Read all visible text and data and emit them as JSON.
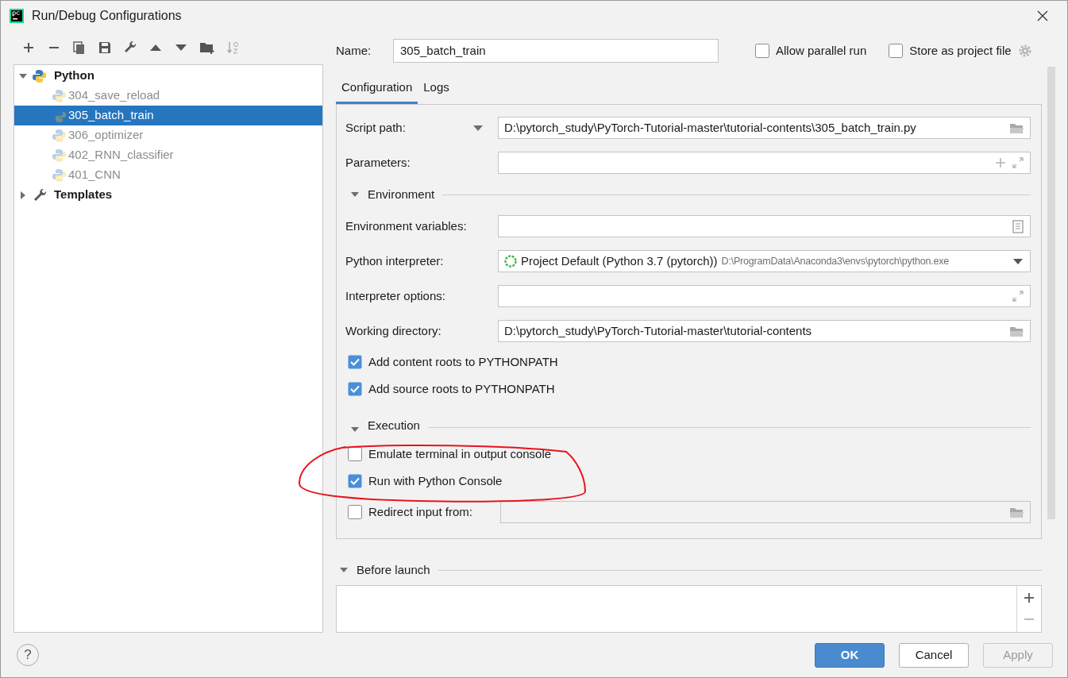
{
  "window": {
    "title": "Run/Debug Configurations"
  },
  "tree": [
    {
      "label": "Python",
      "expanded": true,
      "selected": false,
      "children": [
        {
          "label": "304_save_reload",
          "selected": false
        },
        {
          "label": "305_batch_train",
          "selected": true
        },
        {
          "label": "306_optimizer",
          "selected": false
        },
        {
          "label": "402_RNN_classifier",
          "selected": false
        },
        {
          "label": "401_CNN",
          "selected": false
        }
      ]
    },
    {
      "label": "Templates",
      "expanded": false,
      "selected": false
    }
  ],
  "name": {
    "label": "Name:",
    "value": "305_batch_train"
  },
  "options": [
    {
      "label": "Allow parallel run",
      "checked": false
    },
    {
      "label": "Store as project file",
      "checked": false
    }
  ],
  "tabs": [
    {
      "label": "Configuration",
      "selected": true
    },
    {
      "label": "Logs",
      "selected": false
    }
  ],
  "form": [
    {
      "kind": "script_path",
      "label": "Script path:",
      "value": "D:\\pytorch_study\\PyTorch-Tutorial-master\\tutorial-contents\\305_batch_train.py"
    },
    {
      "kind": "parameters",
      "label": "Parameters:"
    },
    {
      "kind": "section",
      "title": "Environment",
      "expanded": true
    },
    {
      "kind": "env_vars",
      "label": "Environment variables:"
    },
    {
      "kind": "interpreter",
      "label": "Python interpreter:",
      "value": "Project Default (Python 3.7 (pytorch))",
      "detail": "D:\\ProgramData\\Anaconda3\\envs\\pytorch\\python.exe"
    },
    {
      "kind": "interpreter_options",
      "label": "Interpreter options:"
    },
    {
      "kind": "directory",
      "label": "Working directory:",
      "value": "D:\\pytorch_study\\PyTorch-Tutorial-master\\tutorial-contents"
    },
    {
      "kind": "checkbox",
      "label": "Add content roots to PYTHONPATH",
      "checked": true
    },
    {
      "kind": "checkbox",
      "label": "Add source roots to PYTHONPATH",
      "checked": true
    },
    {
      "kind": "section",
      "title": "Execution",
      "expanded": true
    },
    {
      "kind": "checkbox",
      "label": "Emulate terminal in output console",
      "checked": false
    },
    {
      "kind": "checkbox",
      "label": "Run with Python Console",
      "checked": true
    },
    {
      "kind": "checkbox_field",
      "label": "Redirect input from:",
      "checked": false,
      "disabled": true
    }
  ],
  "before_launch": {
    "title": "Before launch",
    "expanded": true
  },
  "help": {
    "label": "?"
  },
  "buttons": [
    {
      "label": "OK",
      "kind": "default",
      "disabled": false
    },
    {
      "label": "Cancel",
      "kind": "normal",
      "disabled": false
    },
    {
      "label": "Apply",
      "kind": "normal",
      "disabled": true
    }
  ]
}
